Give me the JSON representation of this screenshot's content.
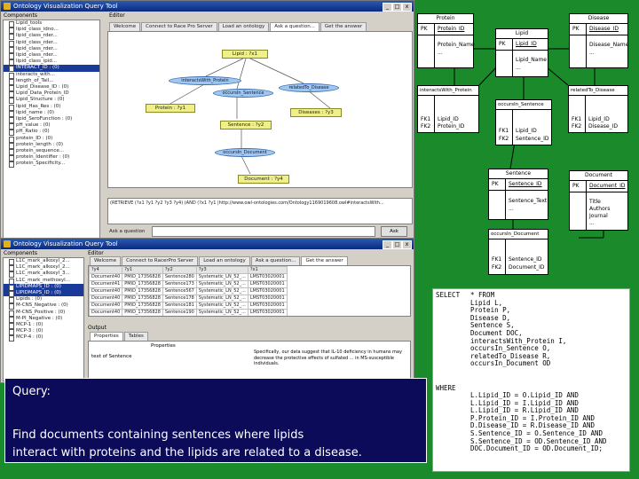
{
  "top_window": {
    "title": "Ontology Visualization Query Tool",
    "components_label": "Components",
    "editor_label": "Editor",
    "tree_items": [
      "Lipid_tools",
      "lipid_class_idno...",
      "lipid_class_rder...",
      "lipid_class_rder...",
      "lipid_class_rder...",
      "lipid_class_rder...",
      "lipid_class_ipid...",
      "INTERACT_ID : (0)",
      "interacts_with...",
      "length_of_Tail...",
      "Lipid_Disease_ID : (0)",
      "Lipid_Data_Protein_ID",
      "Lipid_Structure : (0)",
      "lipid_Has_Res : (0)",
      "lipid_name : (0)",
      "lipid_SeroFunction : (0)",
      "pH_value : (0)",
      "pH_Ratio : (0)",
      "protein_ID : (0)",
      "protein_length : (0)",
      "protein_sequence...",
      "protein_Identifier : (0)",
      "protein_Specificity..."
    ],
    "tabs": [
      "Welcome",
      "Connect to Race Pro Server",
      "Load an ontology",
      "Ask a question...",
      "Get the answer"
    ],
    "graph_nodes": {
      "lipid": "Lipid : ?x1",
      "interacts": "interactsWith_Protein",
      "occurs_sentence": "occursIn_Sentence",
      "related_disease": "relatedTo_Disease",
      "protein": "Protein : ?y1",
      "disease": "Diseases : ?y3",
      "sentence": "Sentence : ?y2",
      "occurs_document": "occursIn_Document",
      "document": "Document : ?y4"
    },
    "query_text": "(RETRIEVE (?x1 ?y1 ?y2 ?y3 ?y4) (AND (?x1 ?y1 |http://www.owl-ontologies.com/Ontology1169019608.owl#interactsWith...",
    "query_field_label": "Ask a question",
    "button_label": "Ask"
  },
  "bottom_window": {
    "title": "Ontology Visualization Query Tool",
    "components_label": "Components",
    "editor_label": "Editor",
    "tree_items": [
      "L1C_mark_alkoxyl_2...",
      "L1C_mark_alkoxyl_2...",
      "L1C_mark_alkoxyl_3...",
      "L1C_mark_methoxyl...",
      "LIPIDMAPS_ID : (0)",
      "LIPIDMAPS_ID : (0)",
      "Lipids : (0)",
      "M-CNS_Negative : (0)",
      "M-CNS_Positive : (0)",
      "M-PI_Negative : (0)",
      "MCP-1 : (0)",
      "MCP-3 : (0)",
      "MCP-4 : (0)"
    ],
    "tabs": [
      "Welcome",
      "Connect to RacerPro Server",
      "Load an ontology",
      "Ask a question...",
      "Get the answer"
    ],
    "results": [
      [
        "Document40",
        "PMID_17356828",
        "Sentence280",
        "Systematic_LN_52_...",
        "LMST03020001"
      ],
      [
        "Document41",
        "PMID_17356828",
        "Sentence173",
        "Systematic_LN_52_...",
        "LMST03020001"
      ],
      [
        "Document40",
        "PMID_17356828",
        "Sentence567",
        "Systematic_LN_52_...",
        "LMST03020001"
      ],
      [
        "Document40",
        "PMID_17356828",
        "Sentence178",
        "Systematic_LN_52_...",
        "LMST03020001"
      ],
      [
        "Document40",
        "PMID_17356828",
        "Sentence181",
        "Systematic_LN_52_...",
        "LMST03020001"
      ],
      [
        "Document40",
        "PMID_17356828",
        "Sentence190",
        "Systematic_LN_52_...",
        "LMST03020001"
      ]
    ],
    "result_headers": [
      "?y4",
      "?y1",
      "?y2",
      "?y3",
      "?x1"
    ],
    "output_label": "Output",
    "output_tabs": [
      "Properties",
      "Tables"
    ],
    "properties_header": "Properties",
    "prop_key": "text of Sentence",
    "prop_value": "Specifically, our data suggest that IL-10 deficiency in humans may decrease the protective effects of sulfated ... in MS-susceptible individuals."
  },
  "er_diagram": {
    "protein": {
      "title": "Protein",
      "pk": "PK",
      "key": "Protein_ID",
      "cols": [
        "Protein_Name",
        "..."
      ]
    },
    "lipid": {
      "title": "Lipid",
      "pk": "PK",
      "key": "Lipid_ID",
      "cols": [
        "Lipid_Name",
        "..."
      ]
    },
    "disease": {
      "title": "Disease",
      "pk": "PK",
      "key": "Disease_ID",
      "cols": [
        "Disease_Name",
        "..."
      ]
    },
    "interacts": {
      "title": "interactsWith_Protein",
      "fk1": "FK1",
      "fk2": "FK2",
      "c1": "Lipid_ID",
      "c2": "Protein_ID"
    },
    "occurs_sentence": {
      "title": "occursIn_Sentence",
      "fk1": "FK1",
      "fk2": "FK2",
      "c1": "Lipid_ID",
      "c2": "Sentence_ID"
    },
    "related": {
      "title": "relatedTo_Disease",
      "fk1": "FK1",
      "fk2": "FK2",
      "c1": "Lipid_ID",
      "c2": "Disease_ID"
    },
    "sentence": {
      "title": "Sentence",
      "pk": "PK",
      "key": "Sentence_ID",
      "cols": [
        "Sentence_Text",
        "..."
      ]
    },
    "document": {
      "title": "Document",
      "pk": "PK",
      "key": "Document_ID",
      "cols": [
        "Title",
        "Authors",
        "Journal",
        "..."
      ]
    },
    "occurs_document": {
      "title": "occursIn_Document",
      "fk1": "FK1",
      "fk2": "FK2",
      "c1": "Sentence_ID",
      "c2": "Document_ID"
    }
  },
  "sql": {
    "select_kw": "SELECT",
    "select_lines": [
      "* FROM",
      "Lipid L,",
      "Protein P,",
      "Disease D,",
      "Sentence S,",
      "Document DOC,",
      "interactsWith_Protein I,",
      "occursIn_Sentence O,",
      "relatedTo_Disease R,",
      "occursIn_Document OD"
    ],
    "where_kw": "WHERE",
    "where_lines": [
      "L.Lipid_ID = O.Lipid_ID AND",
      "L.Lipid_ID = I.Lipid_ID AND",
      "L.Lipid_ID = R.Lipid_ID AND",
      "P.Protein_ID = I.Protein_ID AND",
      "D.Disease_ID = R.Disease_ID AND",
      "S.Sentence_ID = O.Sentence_ID AND",
      "S.Sentence_ID = OD.Sentence_ID AND",
      "DOC.Document_ID = OD.Document_ID;"
    ]
  },
  "query": {
    "heading": "Query:",
    "line1": "Find documents containing sentences where lipids",
    "line2": "interact with proteins and the lipids are related to a disease."
  }
}
